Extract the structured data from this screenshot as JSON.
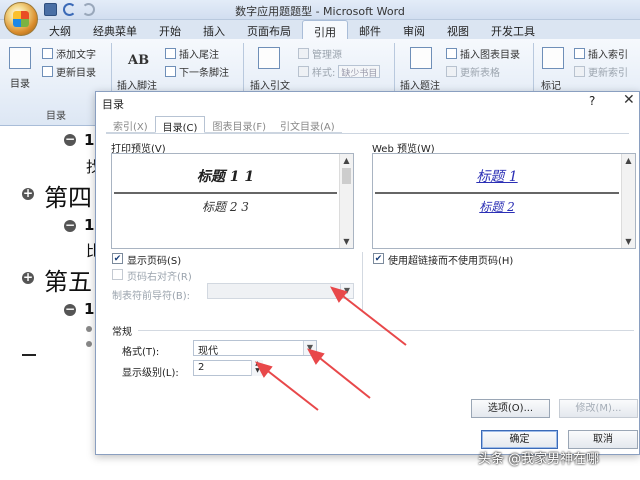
{
  "app": {
    "window_title": "数字应用题题型 - Microsoft Word"
  },
  "ribbon_tabs": [
    "大纲",
    "经典菜单",
    "开始",
    "插入",
    "页面布局",
    "引用",
    "邮件",
    "审阅",
    "视图",
    "开发工具"
  ],
  "active_tab_index": 5,
  "ribbon": {
    "toc": {
      "label": "目录",
      "add_text": "添加文字",
      "update": "更新目录",
      "group": "目录"
    },
    "footnotes": {
      "insert_footnote": "插入脚注",
      "insert_endnote": "插入尾注",
      "next_footnote": "下一条脚注",
      "ab_icon": "AB"
    },
    "citations": {
      "insert_citation": "插入引文",
      "manage_sources": "管理源",
      "style_label": "样式:",
      "style_value": "缺少书目"
    },
    "captions": {
      "insert_caption": "插入题注",
      "insert_table_of_figures": "插入图表目录",
      "update_table": "更新表格"
    },
    "index": {
      "mark_entry": "标记",
      "insert_index": "插入索引",
      "update_index": "更新索引"
    }
  },
  "document": {
    "headings": [
      "第四",
      "第五"
    ],
    "sub_numbers": [
      "1",
      "1",
      "1"
    ],
    "text_chars": [
      "找",
      "比"
    ]
  },
  "dialog": {
    "title": "目录",
    "help": "?",
    "close": "✕",
    "tabs": [
      "索引(X)",
      "目录(C)",
      "图表目录(F)",
      "引文目录(A)"
    ],
    "active_tab_index": 1,
    "print_preview_label": "打印预览(V)",
    "web_preview_label": "Web 预览(W)",
    "print_preview": {
      "heading1": "标题 1 1",
      "heading2": "标题 2 3"
    },
    "web_preview": {
      "heading1": "标题 1",
      "heading2": "标题 2"
    },
    "show_page_numbers": {
      "label": "显示页码(S)",
      "checked": true
    },
    "right_align": {
      "label": "页码右对齐(R)",
      "checked": false,
      "enabled": false
    },
    "tab_leader": {
      "label": "制表符前导符(B):",
      "value": ""
    },
    "use_hyperlinks": {
      "label": "使用超链接而不使用页码(H)",
      "checked": true
    },
    "general_label": "常规",
    "format": {
      "label": "格式(T):",
      "value": "现代"
    },
    "show_levels": {
      "label": "显示级别(L):",
      "value": "2"
    },
    "options_button": "选项(O)...",
    "modify_button": "修改(M)...",
    "ok_button": "确定",
    "cancel_button": "取消"
  },
  "watermark": "头条 @我家男神在哪",
  "colors": {
    "accent": "#3b6ab7",
    "arrow": "#e8484a",
    "link": "#2b2fb5"
  }
}
